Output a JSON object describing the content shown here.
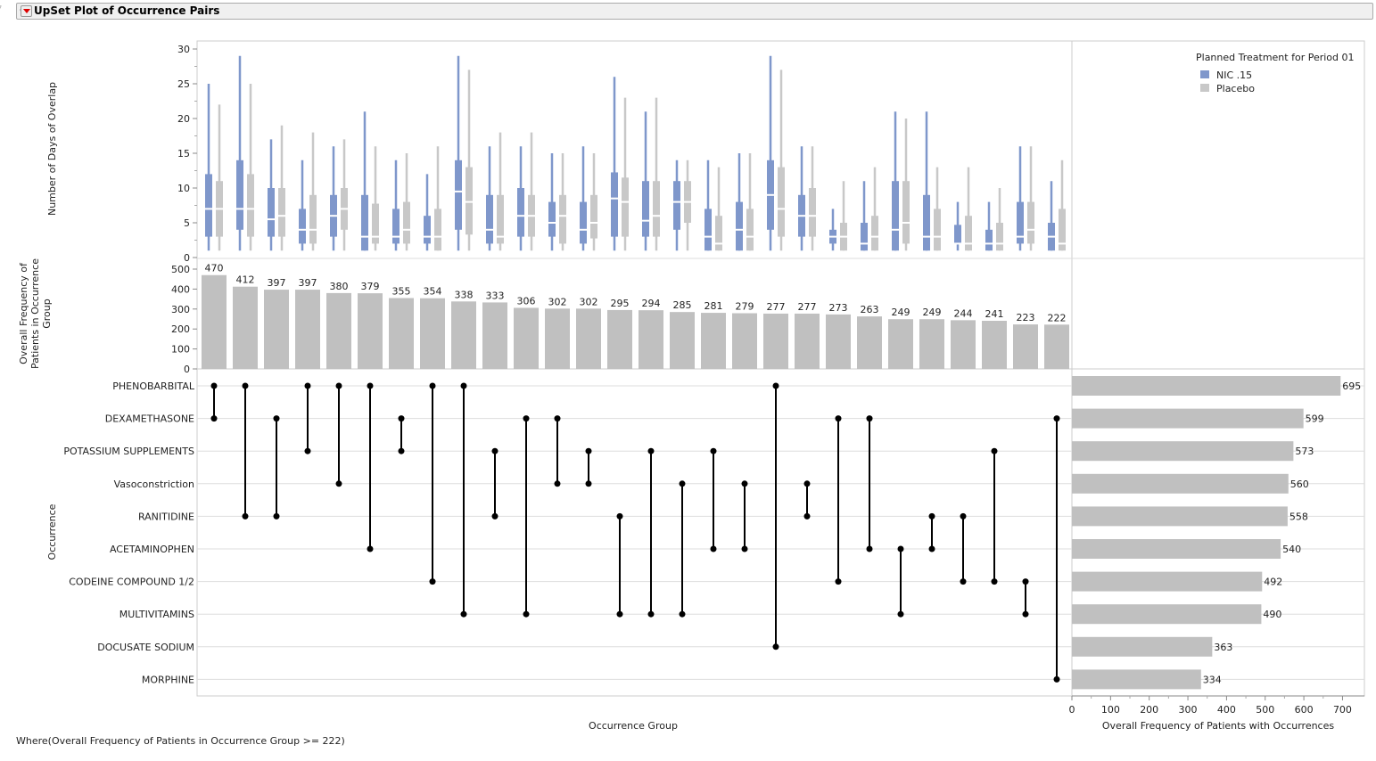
{
  "header": {
    "title": "UpSet Plot of Occurrence Pairs"
  },
  "footer": {
    "where": "Where(Overall Frequency of Patients in Occurrence Group >= 222)"
  },
  "colors": {
    "nic": "#7f97cb",
    "placebo": "#c8c8c8",
    "bar": "#c0c0c0",
    "dot": "#000000"
  },
  "chart_data": {
    "type": "upset",
    "legend": {
      "title": "Planned Treatment for Period 01",
      "entries": [
        "NIC .15",
        "Placebo"
      ],
      "position": "top-right"
    },
    "box_panel": {
      "ylabel": "Number of Days of Overlap",
      "ylim": [
        0,
        30
      ],
      "ticks": [
        "0",
        "5",
        "10",
        "15",
        "20",
        "25",
        "30"
      ],
      "nic": [
        [
          1,
          3,
          7,
          12,
          25
        ],
        [
          1,
          4,
          7,
          14,
          29
        ],
        [
          1,
          3,
          5.5,
          10,
          17
        ],
        [
          1,
          2,
          4,
          7,
          14
        ],
        [
          1,
          3,
          6,
          9,
          16
        ],
        [
          1,
          1,
          3,
          9,
          21
        ],
        [
          1,
          2,
          3,
          7,
          14
        ],
        [
          1,
          2,
          3,
          6,
          12
        ],
        [
          1,
          4,
          9.5,
          14,
          29
        ],
        [
          1,
          2,
          4,
          9,
          16
        ],
        [
          1,
          3,
          6,
          10,
          16
        ],
        [
          1,
          3,
          5,
          8,
          15
        ],
        [
          1,
          2,
          4,
          8,
          16
        ],
        [
          1,
          3,
          8.5,
          12.25,
          26
        ],
        [
          1,
          3,
          5.3,
          11,
          21
        ],
        [
          1,
          4,
          8,
          11,
          14
        ],
        [
          1,
          1,
          3,
          7,
          14
        ],
        [
          1,
          1,
          4,
          8,
          15
        ],
        [
          1,
          4,
          9,
          14,
          29
        ],
        [
          1,
          3,
          6,
          9,
          16
        ],
        [
          1,
          2,
          3,
          4,
          7
        ],
        [
          1,
          1,
          2,
          5,
          11
        ],
        [
          1,
          1,
          4,
          11,
          21
        ],
        [
          1,
          1,
          3,
          9,
          21
        ],
        [
          1,
          2,
          2,
          4.7,
          8
        ],
        [
          1,
          1,
          2,
          4,
          8
        ],
        [
          1,
          2,
          3,
          8,
          16
        ],
        [
          1,
          1,
          3,
          5,
          11
        ]
      ],
      "placebo": [
        [
          1,
          3,
          7,
          11,
          22
        ],
        [
          1,
          3,
          7,
          12,
          25
        ],
        [
          1,
          3,
          6,
          10,
          19
        ],
        [
          1,
          2,
          4,
          9,
          18
        ],
        [
          1,
          4,
          7,
          10,
          17
        ],
        [
          1,
          2,
          3,
          7.75,
          16
        ],
        [
          1,
          2,
          4,
          8,
          15
        ],
        [
          1,
          1,
          3,
          7,
          16
        ],
        [
          1,
          3.3,
          8,
          13,
          27
        ],
        [
          1,
          2,
          3,
          9,
          18
        ],
        [
          1,
          3,
          6,
          9,
          18
        ],
        [
          1,
          2,
          6,
          9,
          15
        ],
        [
          1,
          2.75,
          5,
          9,
          15
        ],
        [
          1,
          3,
          8,
          11.5,
          23
        ],
        [
          1,
          3,
          6,
          11,
          23
        ],
        [
          1,
          5,
          8,
          11,
          14
        ],
        [
          1,
          1,
          2,
          6,
          13
        ],
        [
          1,
          1,
          3,
          7,
          15
        ],
        [
          1,
          3,
          7,
          13,
          27
        ],
        [
          1,
          3,
          6,
          10,
          16
        ],
        [
          1,
          1,
          3,
          5,
          11
        ],
        [
          1,
          1,
          3,
          6,
          13
        ],
        [
          1,
          2,
          5,
          11,
          20
        ],
        [
          1,
          1,
          3,
          7,
          13
        ],
        [
          1,
          1,
          2,
          6,
          13
        ],
        [
          1,
          1,
          2,
          5,
          10
        ],
        [
          1,
          2,
          4,
          8,
          16
        ],
        [
          1,
          1,
          2,
          7,
          14
        ]
      ]
    },
    "bar_panel": {
      "ylabel": "Overall Frequency of Patients in Occurrence Group",
      "ylim": [
        0,
        500
      ],
      "ticks": [
        "0",
        "100",
        "200",
        "300",
        "400",
        "500"
      ],
      "values": [
        470,
        412,
        397,
        397,
        380,
        379,
        355,
        354,
        338,
        333,
        306,
        302,
        302,
        295,
        294,
        285,
        281,
        279,
        277,
        277,
        273,
        263,
        249,
        249,
        244,
        241,
        223,
        222
      ],
      "labels": [
        "470",
        "412",
        "397",
        "397",
        "380",
        "379",
        "355",
        "354",
        "338",
        "333",
        "306",
        "302",
        "302",
        "295",
        "294",
        "285",
        "281",
        "279",
        "277",
        "277",
        "273",
        "263",
        "249",
        "249",
        "244",
        "241",
        "223",
        "222"
      ]
    },
    "matrix": {
      "ylabel": "Occurrence",
      "xlabel": "Occurrence Group",
      "sets": [
        "PHENOBARBITAL",
        "DEXAMETHASONE",
        "POTASSIUM SUPPLEMENTS",
        "Vasoconstriction",
        "RANITIDINE",
        "ACETAMINOPHEN",
        "CODEINE COMPOUND 1/2",
        "MULTIVITAMINS",
        "DOCUSATE SODIUM",
        "MORPHINE"
      ],
      "pairs": [
        [
          0,
          1
        ],
        [
          0,
          4
        ],
        [
          1,
          4
        ],
        [
          0,
          2
        ],
        [
          0,
          3
        ],
        [
          0,
          5
        ],
        [
          1,
          2
        ],
        [
          0,
          6
        ],
        [
          0,
          7
        ],
        [
          2,
          4
        ],
        [
          1,
          7
        ],
        [
          1,
          3
        ],
        [
          2,
          3
        ],
        [
          4,
          7
        ],
        [
          2,
          7
        ],
        [
          3,
          7
        ],
        [
          2,
          5
        ],
        [
          3,
          5
        ],
        [
          0,
          8
        ],
        [
          3,
          4
        ],
        [
          1,
          6
        ],
        [
          1,
          5
        ],
        [
          5,
          7
        ],
        [
          4,
          5
        ],
        [
          4,
          6
        ],
        [
          2,
          6
        ],
        [
          6,
          7
        ],
        [
          1,
          9
        ]
      ]
    },
    "set_sizes": {
      "xlabel": "Overall Frequency of Patients with Occurrences",
      "xlim": [
        0,
        750
      ],
      "ticks": [
        "0",
        "100",
        "200",
        "300",
        "400",
        "500",
        "600",
        "700"
      ],
      "values": [
        695,
        599,
        573,
        560,
        558,
        540,
        492,
        490,
        363,
        334
      ],
      "labels": [
        "695",
        "599",
        "573",
        "560",
        "558",
        "540",
        "492",
        "490",
        "363",
        "334"
      ]
    }
  }
}
